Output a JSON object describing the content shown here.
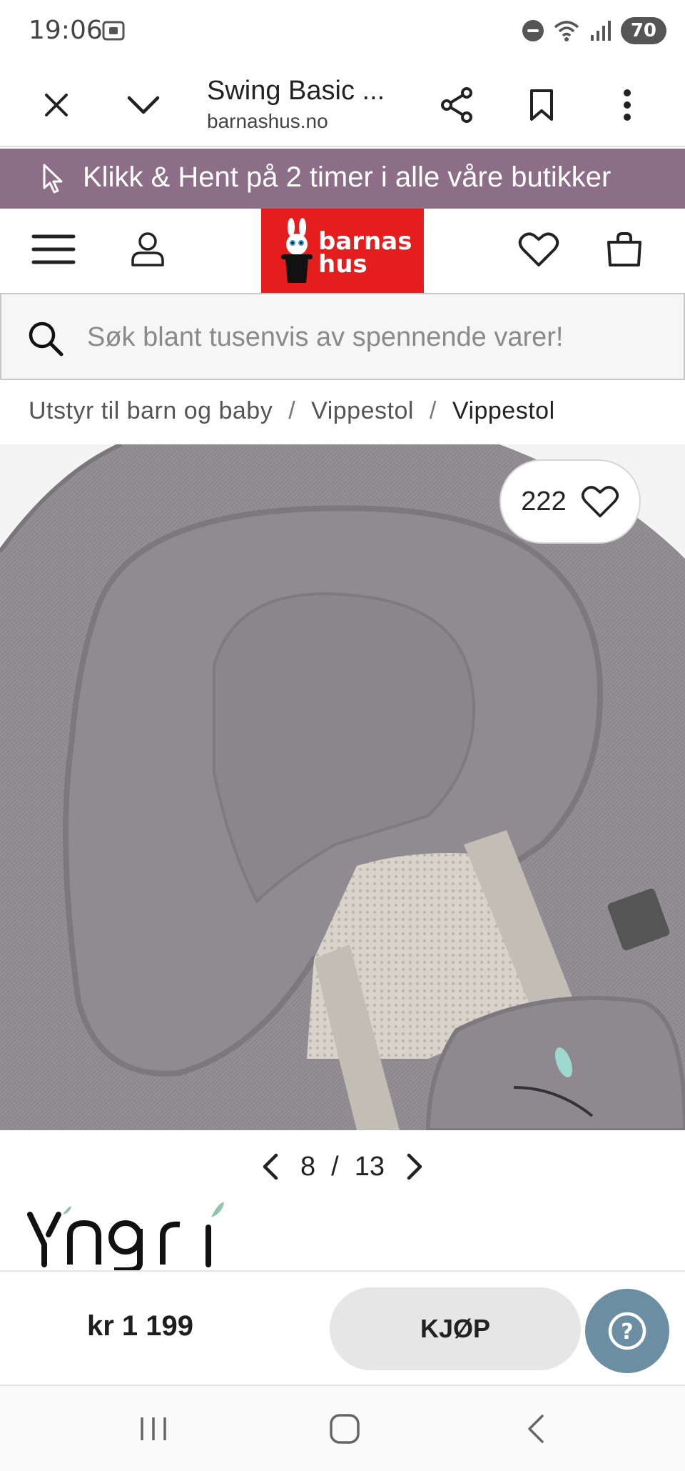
{
  "status_bar": {
    "time": "19:06",
    "battery": "70"
  },
  "tab_bar": {
    "title": "Swing Basic ...",
    "domain": "barnashus.no"
  },
  "promo": {
    "text": "Klikk & Hent på 2 timer i alle våre butikker"
  },
  "header": {
    "logo_line1": "barnas",
    "logo_line2": "hus",
    "brand_color": "#e51d1d"
  },
  "search": {
    "placeholder": "Søk blant tusenvis av spennende varer!"
  },
  "breadcrumb": {
    "items": [
      "Utstyr til barn og baby",
      "Vippestol",
      "Vippestol"
    ],
    "separator": "/"
  },
  "product": {
    "like_count": "222",
    "image_index": "8",
    "image_total": "13",
    "pager_separator": "/",
    "brand": "Yngri",
    "price": "kr 1 199",
    "buy_label": "KJØP",
    "help_label": "?"
  },
  "colors": {
    "promo_bg": "#8c6f86",
    "help_bg": "#6b8ea3",
    "buy_bg": "#e6e6e6"
  }
}
